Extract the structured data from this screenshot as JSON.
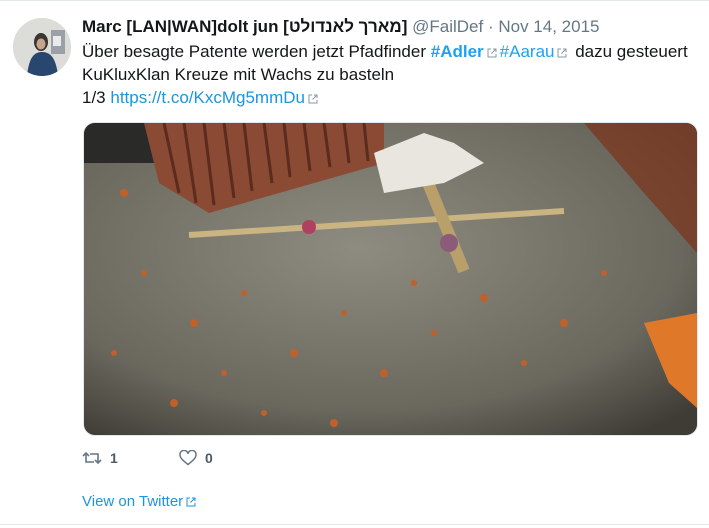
{
  "tweet": {
    "display_name": "Marc [LAN|WAN]dolt jun [מארך לאנדולט]",
    "handle": "@FailDef",
    "separator": "·",
    "date": "Nov 14, 2015",
    "text_part1": "Über besagte Patente werden jetzt Pfadfinder",
    "hashtag1": "#Adler",
    "hashtag2": "#Aarau",
    "text_part2": "dazu gesteuert",
    "text_line2": "KuKluxKlan Kreuze mit Wachs zu basteln",
    "counter": "1/3",
    "link": "https://t.co/KxcMg5mmDu"
  },
  "actions": {
    "retweet_count": "1",
    "like_count": "0"
  },
  "footer": {
    "view_label": "View on Twitter"
  },
  "icons": {
    "retweet": "retweet-icon",
    "like": "heart-icon",
    "external": "external-link-icon"
  },
  "colors": {
    "link": "#1b95e0",
    "muted": "#657786",
    "text": "#14171a"
  }
}
